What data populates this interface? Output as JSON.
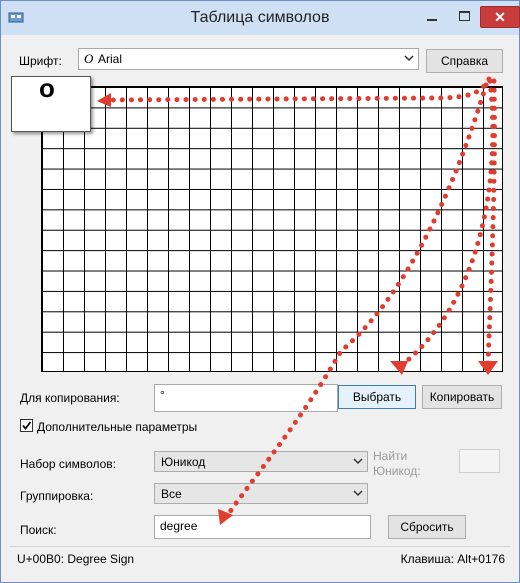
{
  "window": {
    "title": "Таблица символов"
  },
  "font": {
    "label": "Шрифт:",
    "value": "Arial",
    "glyph": "O"
  },
  "help_button": "Справка",
  "preview_char": "o",
  "copy": {
    "label": "Для копирования:",
    "value": "°"
  },
  "buttons": {
    "select": "Выбрать",
    "copy": "Копировать",
    "reset": "Сбросить"
  },
  "advanced": {
    "label": "Дополнительные параметры",
    "checked": true
  },
  "charset": {
    "label": "Набор символов:",
    "value": "Юникод"
  },
  "goto_unicode": {
    "label_line1": "Найти",
    "label_line2": "Юникод:",
    "value": ""
  },
  "grouping": {
    "label": "Группировка:",
    "value": "Все"
  },
  "search": {
    "label": "Поиск:",
    "value": "degree"
  },
  "status": {
    "left": "U+00B0: Degree Sign",
    "right": "Клавиша: Alt+0176"
  },
  "colors": {
    "title_bar": "#cfe0f5",
    "close_button": "#c83c3c",
    "annotation_arrows": "#e03c2f"
  }
}
